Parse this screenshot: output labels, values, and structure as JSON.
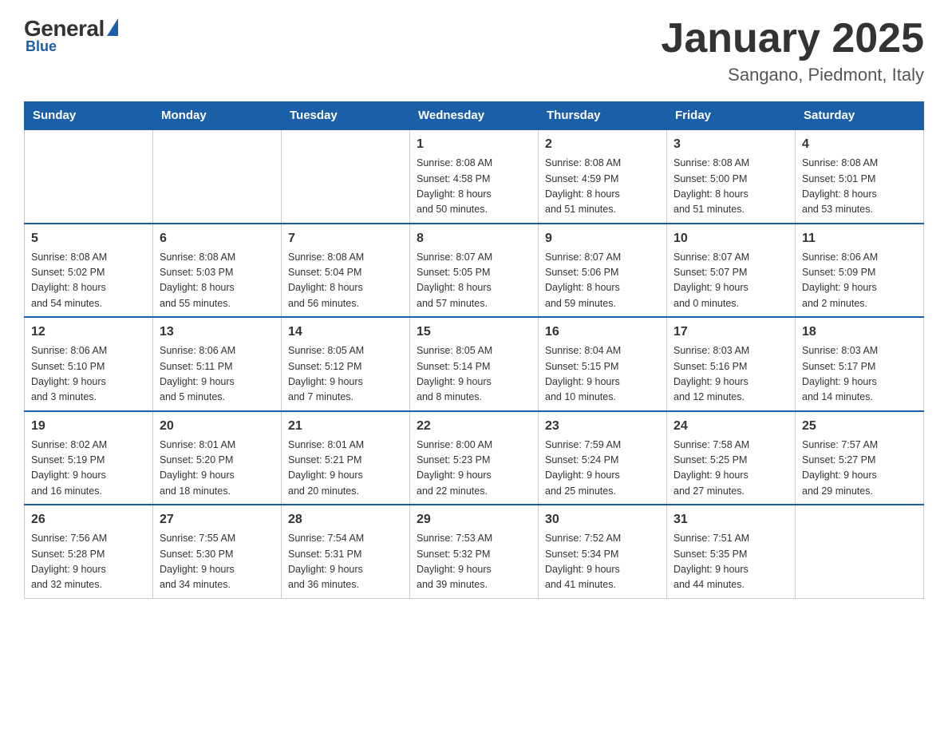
{
  "logo": {
    "general": "General",
    "blue": "Blue",
    "triangle_color": "#1a5fa8"
  },
  "title": {
    "month_year": "January 2025",
    "location": "Sangano, Piedmont, Italy"
  },
  "days_of_week": [
    "Sunday",
    "Monday",
    "Tuesday",
    "Wednesday",
    "Thursday",
    "Friday",
    "Saturday"
  ],
  "weeks": [
    [
      {
        "day": "",
        "info": ""
      },
      {
        "day": "",
        "info": ""
      },
      {
        "day": "",
        "info": ""
      },
      {
        "day": "1",
        "info": "Sunrise: 8:08 AM\nSunset: 4:58 PM\nDaylight: 8 hours\nand 50 minutes."
      },
      {
        "day": "2",
        "info": "Sunrise: 8:08 AM\nSunset: 4:59 PM\nDaylight: 8 hours\nand 51 minutes."
      },
      {
        "day": "3",
        "info": "Sunrise: 8:08 AM\nSunset: 5:00 PM\nDaylight: 8 hours\nand 51 minutes."
      },
      {
        "day": "4",
        "info": "Sunrise: 8:08 AM\nSunset: 5:01 PM\nDaylight: 8 hours\nand 53 minutes."
      }
    ],
    [
      {
        "day": "5",
        "info": "Sunrise: 8:08 AM\nSunset: 5:02 PM\nDaylight: 8 hours\nand 54 minutes."
      },
      {
        "day": "6",
        "info": "Sunrise: 8:08 AM\nSunset: 5:03 PM\nDaylight: 8 hours\nand 55 minutes."
      },
      {
        "day": "7",
        "info": "Sunrise: 8:08 AM\nSunset: 5:04 PM\nDaylight: 8 hours\nand 56 minutes."
      },
      {
        "day": "8",
        "info": "Sunrise: 8:07 AM\nSunset: 5:05 PM\nDaylight: 8 hours\nand 57 minutes."
      },
      {
        "day": "9",
        "info": "Sunrise: 8:07 AM\nSunset: 5:06 PM\nDaylight: 8 hours\nand 59 minutes."
      },
      {
        "day": "10",
        "info": "Sunrise: 8:07 AM\nSunset: 5:07 PM\nDaylight: 9 hours\nand 0 minutes."
      },
      {
        "day": "11",
        "info": "Sunrise: 8:06 AM\nSunset: 5:09 PM\nDaylight: 9 hours\nand 2 minutes."
      }
    ],
    [
      {
        "day": "12",
        "info": "Sunrise: 8:06 AM\nSunset: 5:10 PM\nDaylight: 9 hours\nand 3 minutes."
      },
      {
        "day": "13",
        "info": "Sunrise: 8:06 AM\nSunset: 5:11 PM\nDaylight: 9 hours\nand 5 minutes."
      },
      {
        "day": "14",
        "info": "Sunrise: 8:05 AM\nSunset: 5:12 PM\nDaylight: 9 hours\nand 7 minutes."
      },
      {
        "day": "15",
        "info": "Sunrise: 8:05 AM\nSunset: 5:14 PM\nDaylight: 9 hours\nand 8 minutes."
      },
      {
        "day": "16",
        "info": "Sunrise: 8:04 AM\nSunset: 5:15 PM\nDaylight: 9 hours\nand 10 minutes."
      },
      {
        "day": "17",
        "info": "Sunrise: 8:03 AM\nSunset: 5:16 PM\nDaylight: 9 hours\nand 12 minutes."
      },
      {
        "day": "18",
        "info": "Sunrise: 8:03 AM\nSunset: 5:17 PM\nDaylight: 9 hours\nand 14 minutes."
      }
    ],
    [
      {
        "day": "19",
        "info": "Sunrise: 8:02 AM\nSunset: 5:19 PM\nDaylight: 9 hours\nand 16 minutes."
      },
      {
        "day": "20",
        "info": "Sunrise: 8:01 AM\nSunset: 5:20 PM\nDaylight: 9 hours\nand 18 minutes."
      },
      {
        "day": "21",
        "info": "Sunrise: 8:01 AM\nSunset: 5:21 PM\nDaylight: 9 hours\nand 20 minutes."
      },
      {
        "day": "22",
        "info": "Sunrise: 8:00 AM\nSunset: 5:23 PM\nDaylight: 9 hours\nand 22 minutes."
      },
      {
        "day": "23",
        "info": "Sunrise: 7:59 AM\nSunset: 5:24 PM\nDaylight: 9 hours\nand 25 minutes."
      },
      {
        "day": "24",
        "info": "Sunrise: 7:58 AM\nSunset: 5:25 PM\nDaylight: 9 hours\nand 27 minutes."
      },
      {
        "day": "25",
        "info": "Sunrise: 7:57 AM\nSunset: 5:27 PM\nDaylight: 9 hours\nand 29 minutes."
      }
    ],
    [
      {
        "day": "26",
        "info": "Sunrise: 7:56 AM\nSunset: 5:28 PM\nDaylight: 9 hours\nand 32 minutes."
      },
      {
        "day": "27",
        "info": "Sunrise: 7:55 AM\nSunset: 5:30 PM\nDaylight: 9 hours\nand 34 minutes."
      },
      {
        "day": "28",
        "info": "Sunrise: 7:54 AM\nSunset: 5:31 PM\nDaylight: 9 hours\nand 36 minutes."
      },
      {
        "day": "29",
        "info": "Sunrise: 7:53 AM\nSunset: 5:32 PM\nDaylight: 9 hours\nand 39 minutes."
      },
      {
        "day": "30",
        "info": "Sunrise: 7:52 AM\nSunset: 5:34 PM\nDaylight: 9 hours\nand 41 minutes."
      },
      {
        "day": "31",
        "info": "Sunrise: 7:51 AM\nSunset: 5:35 PM\nDaylight: 9 hours\nand 44 minutes."
      },
      {
        "day": "",
        "info": ""
      }
    ]
  ]
}
